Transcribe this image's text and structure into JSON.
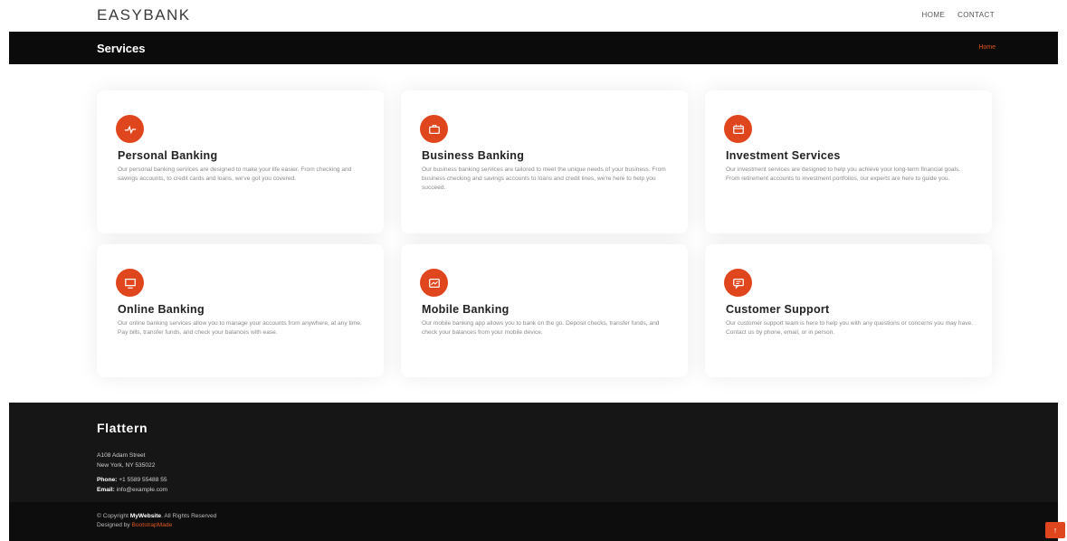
{
  "header": {
    "brand": "EASYBANK",
    "nav": [
      "HOME",
      "CONTACT"
    ]
  },
  "titlebar": {
    "title": "Services",
    "crumb": "Home"
  },
  "cards": [
    {
      "icon": "pulse-icon",
      "title": "Personal Banking",
      "text": "Our personal banking services are designed to make your life easier. From checking and savings accounts, to credit cards and loans, we've got you covered."
    },
    {
      "icon": "briefcase-icon",
      "title": "Business Banking",
      "text": "Our business banking services are tailored to meet the unique needs of your business. From business checking and savings accounts to loans and credit lines, we're here to help you succeed."
    },
    {
      "icon": "calendar-icon",
      "title": "Investment Services",
      "text": "Our investment services are designed to help you achieve your long-term financial goals. From retirement accounts to investment portfolios, our experts are here to guide you."
    },
    {
      "icon": "monitor-icon",
      "title": "Online Banking",
      "text": "Our online banking services allow you to manage your accounts from anywhere, at any time. Pay bills, transfer funds, and check your balances with ease."
    },
    {
      "icon": "mobile-icon",
      "title": "Mobile Banking",
      "text": "Our mobile banking app allows you to bank on the go. Deposit checks, transfer funds, and check your balances from your mobile device."
    },
    {
      "icon": "chat-icon",
      "title": "Customer Support",
      "text": "Our customer support team is here to help you with any questions or concerns you may have. Contact us by phone, email, or in person."
    }
  ],
  "footer": {
    "title": "Flattern",
    "address1": "A108 Adam Street",
    "address2": "New York, NY 535022",
    "phone_label": "Phone:",
    "phone": "+1 5589 55488 55",
    "email_label": "Email:",
    "email": "info@example.com",
    "copyright_prefix": "© Copyright",
    "copyright_brand": "MyWebsite",
    "copyright_suffix": ". All Rights Reserved",
    "designed_label": "Designed by",
    "designed_by": "BootstrapMade"
  },
  "back_to_top": "↑",
  "colors": {
    "accent": "#e0461d",
    "dark": "#0b0b0b",
    "footer": "#161616"
  }
}
